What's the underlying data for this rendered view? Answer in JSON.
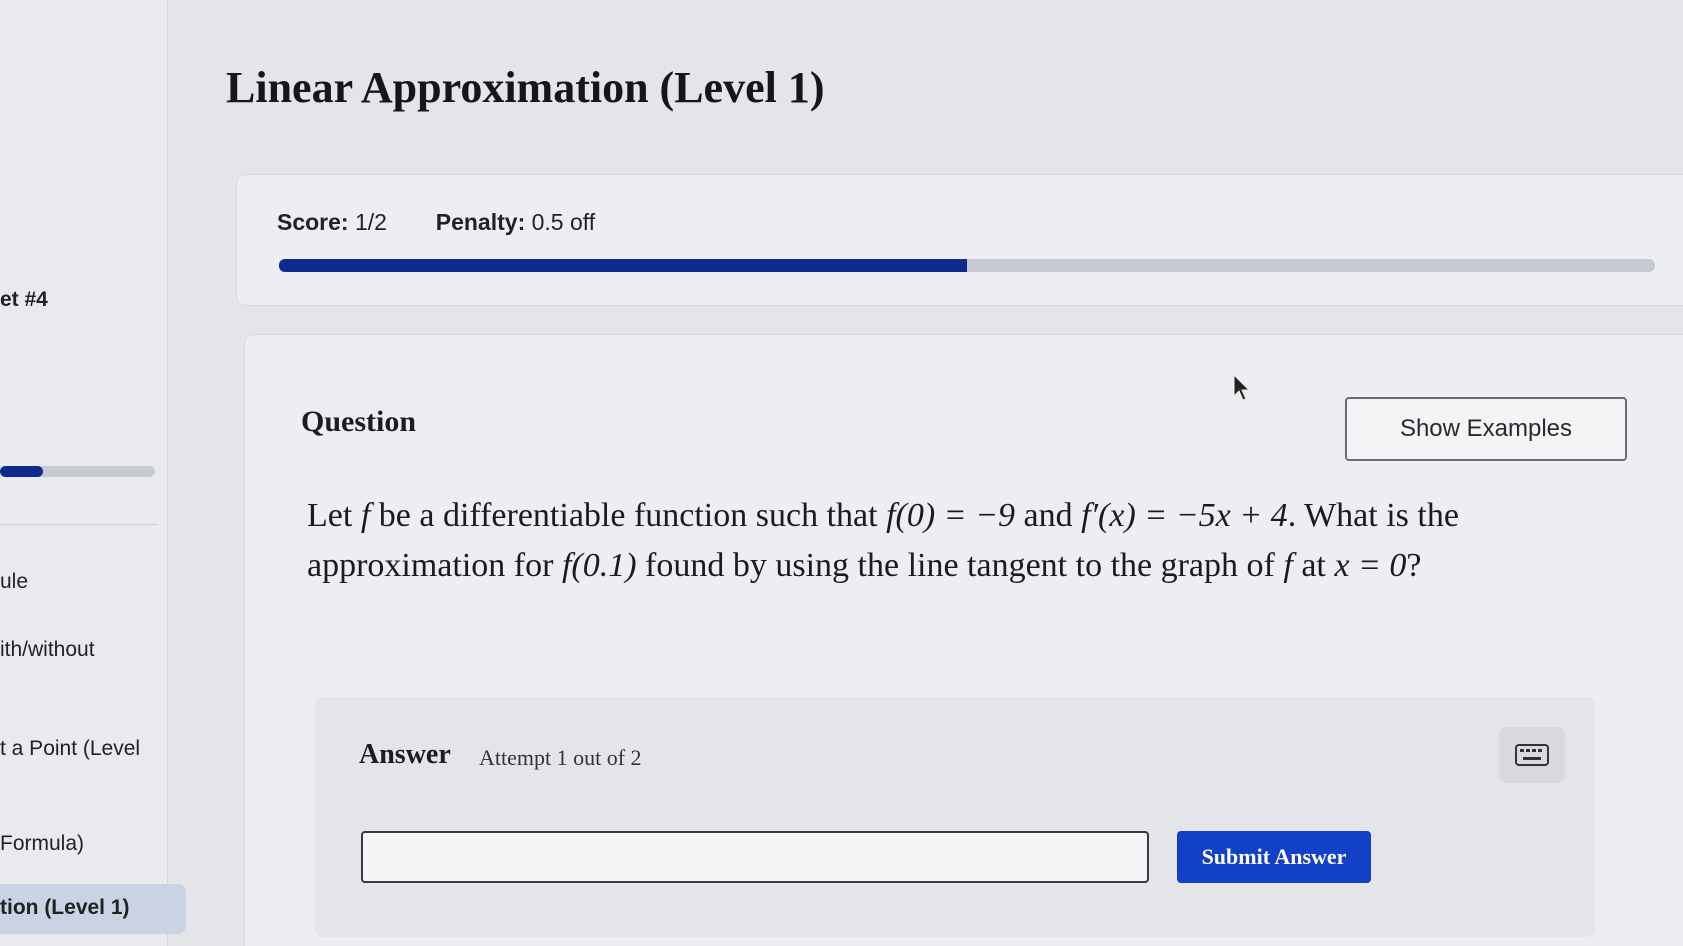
{
  "sidebar": {
    "set_label": "et #4",
    "progress": 0.28,
    "items": [
      {
        "label": "ule"
      },
      {
        "label": "ith/without"
      },
      {
        "label": "t a Point (Level"
      },
      {
        "label": "Formula)"
      },
      {
        "label": "tion (Level 1)",
        "active": true
      }
    ]
  },
  "page": {
    "title": "Linear Approximation (Level 1)"
  },
  "score": {
    "score_label": "Score:",
    "score_value": "1/2",
    "penalty_label": "Penalty:",
    "penalty_value": "0.5 off",
    "progress": 0.5
  },
  "question": {
    "label": "Question",
    "show_examples": "Show Examples",
    "parts": {
      "p1": "Let ",
      "f1": "f",
      "p2": " be a differentiable function such that ",
      "e1": "f(0) = −9",
      "p3": " and ",
      "e2": "f′(x) = −5x + 4",
      "p4": ". What is the approximation for ",
      "e3": "f(0.1)",
      "p5": " found by using the line tangent to the graph of ",
      "f2": "f",
      "p6": " at ",
      "e4": "x = 0",
      "p7": "?"
    }
  },
  "answer": {
    "label": "Answer",
    "attempt": "Attempt 1 out of 2",
    "input_value": "",
    "submit_label": "Submit Answer",
    "keyboard_icon": "keyboard-icon"
  },
  "colors": {
    "accent": "#0f2a8c",
    "submit": "#1241c8"
  }
}
